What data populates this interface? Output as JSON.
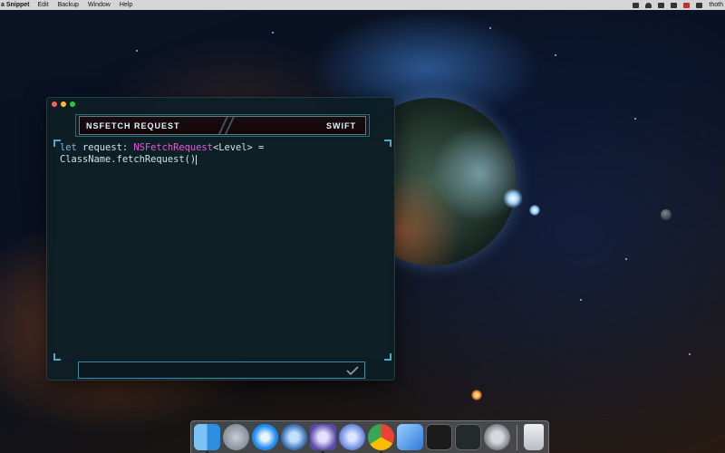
{
  "menubar": {
    "app_name": "a Snippet",
    "items": [
      "Edit",
      "Backup",
      "Window",
      "Help"
    ],
    "user": "thoth"
  },
  "window": {
    "header_title": "NSFETCH REQUEST",
    "language": "SWIFT",
    "code": {
      "line1": {
        "keyword": "let",
        "plain1": " request: ",
        "type": "NSFetchRequest",
        "plain2": "<Level> ="
      },
      "line2": "ClassName.fetchRequest()"
    }
  },
  "dock": {
    "apps": [
      {
        "name": "finder-icon",
        "color": "#2f8de0"
      },
      {
        "name": "launchpad-icon",
        "color": "#8a94a6"
      },
      {
        "name": "safari-icon",
        "color": "#1d8cf0"
      },
      {
        "name": "quicktime-icon",
        "color": "#3a6fb0"
      },
      {
        "name": "bbedit-icon",
        "color": "#5a4aa8"
      },
      {
        "name": "network-radar-icon",
        "color": "#5f7fd8"
      },
      {
        "name": "chrome-icon",
        "color": "#4caf50"
      },
      {
        "name": "xcode-icon",
        "color": "#2f7ad8"
      },
      {
        "name": "terminal-icon",
        "color": "#1b1b1b"
      },
      {
        "name": "activity-monitor-icon",
        "color": "#222a2a"
      },
      {
        "name": "system-preferences-icon",
        "color": "#7b7f85"
      }
    ],
    "trash": {
      "name": "trash-icon",
      "color": "#c9cdd1"
    }
  },
  "colors": {
    "accent": "#4fa8c8",
    "keyword": "#7fb3e8",
    "type": "#e25ad9",
    "window_bg": "#0d1e24"
  }
}
